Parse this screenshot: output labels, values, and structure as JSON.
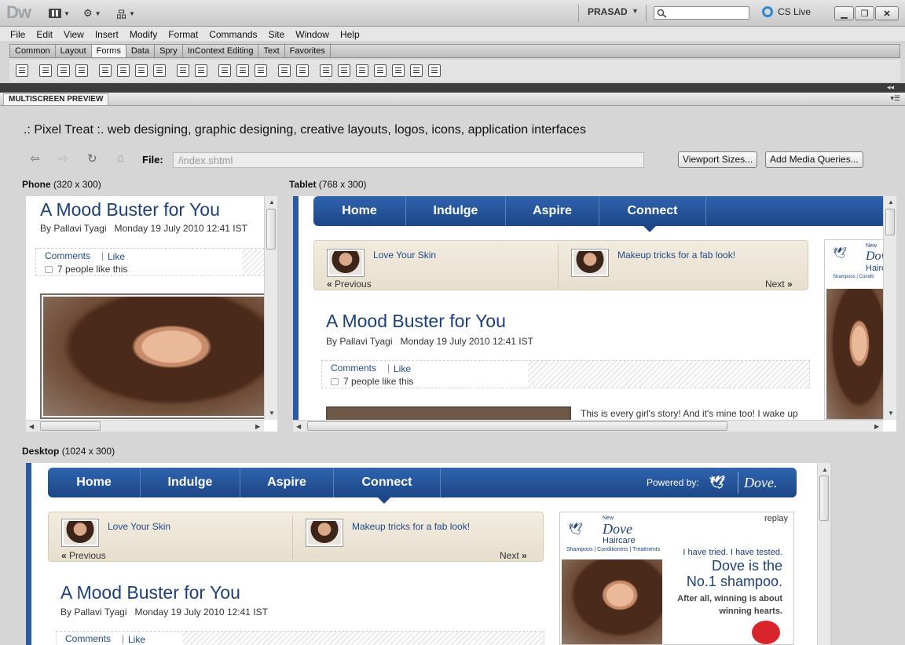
{
  "app": {
    "logo": "Dw",
    "user": "PRASAD",
    "cslive": "CS Live"
  },
  "menu": [
    "File",
    "Edit",
    "View",
    "Insert",
    "Modify",
    "Format",
    "Commands",
    "Site",
    "Window",
    "Help"
  ],
  "insert_tabs": [
    "Common",
    "Layout",
    "Forms",
    "Data",
    "Spry",
    "InContext Editing",
    "Text",
    "Favorites"
  ],
  "active_insert_tab": "Forms",
  "panel": {
    "title": "MULTISCREEN PREVIEW"
  },
  "page_title": ".: Pixel Treat :. web designing, graphic designing, creative layouts, logos, icons, application interfaces",
  "file": {
    "label": "File:",
    "value": "/index.shtml"
  },
  "buttons": {
    "viewport": "Viewport Sizes...",
    "media": "Add Media Queries..."
  },
  "previews": {
    "phone": {
      "name": "Phone",
      "size": "(320 x 300)"
    },
    "tablet": {
      "name": "Tablet",
      "size": "(768 x 300)"
    },
    "desktop": {
      "name": "Desktop",
      "size": "(1024 x 300)"
    }
  },
  "article": {
    "title": "A Mood Buster for You",
    "author": "By Pallavi Tyagi",
    "date": "Monday 19 July 2010 12:41 IST",
    "comments": "Comments",
    "sep": "|",
    "like": "Like",
    "likes_count": "7 people like this",
    "excerpt": "This is every girl's story! And it's mine too! I wake up"
  },
  "site_nav": [
    "Home",
    "Indulge",
    "Aspire",
    "Connect"
  ],
  "powered_by": "Powered by:",
  "dove_logo": "Dove.",
  "slides": {
    "left": "Love Your Skin",
    "right": "Makeup tricks for a fab look!",
    "prev": "Previous",
    "next": "Next"
  },
  "ad": {
    "replay": "replay",
    "new": "New",
    "brand": "Dove",
    "sub": "Haircare",
    "lines": "Shampoos | Conditioners | Treatments",
    "tagline1": "I have tried. I have tested.",
    "tagline2": "Dove is the",
    "tagline3": "No.1 shampoo.",
    "tagline4": "After all, winning is about",
    "tagline5": "winning hearts.",
    "tablet_lines": "Shampoos | Conditi"
  },
  "colors": {
    "accent": "#1c4688",
    "title": "#1c3f7a"
  }
}
